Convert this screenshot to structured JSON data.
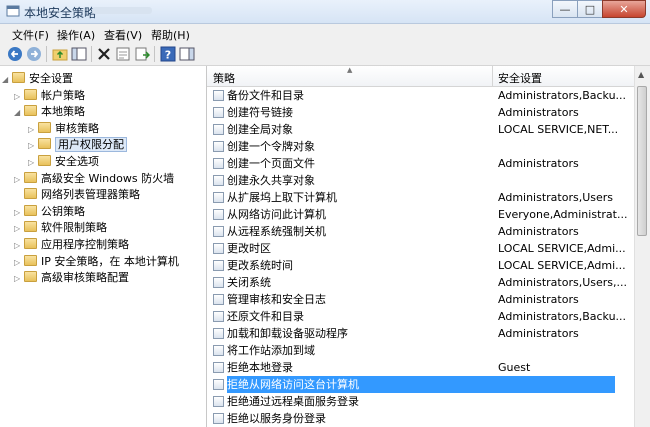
{
  "window": {
    "title": "本地安全策略",
    "close_label": "✕",
    "min_label": "—",
    "max_label": "□"
  },
  "menu": [
    "文件(F)",
    "操作(A)",
    "查看(V)",
    "帮助(H)"
  ],
  "tree": [
    {
      "label": "安全设置",
      "level": 0,
      "expanded": true
    },
    {
      "label": "帐户策略",
      "level": 1,
      "expanded": false
    },
    {
      "label": "本地策略",
      "level": 1,
      "expanded": true
    },
    {
      "label": "审核策略",
      "level": 2,
      "expanded": false
    },
    {
      "label": "用户权限分配",
      "level": 2,
      "expanded": false,
      "selected": true
    },
    {
      "label": "安全选项",
      "level": 2,
      "expanded": false
    },
    {
      "label": "高级安全 Windows 防火墙",
      "level": 1,
      "expanded": false
    },
    {
      "label": "网络列表管理器策略",
      "level": 1,
      "expanded": null
    },
    {
      "label": "公钥策略",
      "level": 1,
      "expanded": false
    },
    {
      "label": "软件限制策略",
      "level": 1,
      "expanded": false
    },
    {
      "label": "应用程序控制策略",
      "level": 1,
      "expanded": false
    },
    {
      "label": "IP 安全策略，在 本地计算机",
      "level": 1,
      "expanded": false
    },
    {
      "label": "高级审核策略配置",
      "level": 1,
      "expanded": false
    }
  ],
  "columns": {
    "policy": "策略",
    "setting": "安全设置"
  },
  "rows": [
    {
      "policy": "备份文件和目录",
      "setting": "Administrators,Backu..."
    },
    {
      "policy": "创建符号链接",
      "setting": "Administrators"
    },
    {
      "policy": "创建全局对象",
      "setting": "LOCAL SERVICE,NET..."
    },
    {
      "policy": "创建一个令牌对象",
      "setting": ""
    },
    {
      "policy": "创建一个页面文件",
      "setting": "Administrators"
    },
    {
      "policy": "创建永久共享对象",
      "setting": ""
    },
    {
      "policy": "从扩展坞上取下计算机",
      "setting": "Administrators,Users"
    },
    {
      "policy": "从网络访问此计算机",
      "setting": "Everyone,Administrat..."
    },
    {
      "policy": "从远程系统强制关机",
      "setting": "Administrators"
    },
    {
      "policy": "更改时区",
      "setting": "LOCAL SERVICE,Admi..."
    },
    {
      "policy": "更改系统时间",
      "setting": "LOCAL SERVICE,Admi..."
    },
    {
      "policy": "关闭系统",
      "setting": "Administrators,Users,..."
    },
    {
      "policy": "管理审核和安全日志",
      "setting": "Administrators"
    },
    {
      "policy": "还原文件和目录",
      "setting": "Administrators,Backu..."
    },
    {
      "policy": "加载和卸载设备驱动程序",
      "setting": "Administrators"
    },
    {
      "policy": "将工作站添加到域",
      "setting": ""
    },
    {
      "policy": "拒绝本地登录",
      "setting": "Guest"
    },
    {
      "policy": "拒绝从网络访问这台计算机",
      "setting": "",
      "highlight": true
    },
    {
      "policy": "拒绝通过远程桌面服务登录",
      "setting": ""
    },
    {
      "policy": "拒绝以服务身份登录",
      "setting": ""
    }
  ]
}
